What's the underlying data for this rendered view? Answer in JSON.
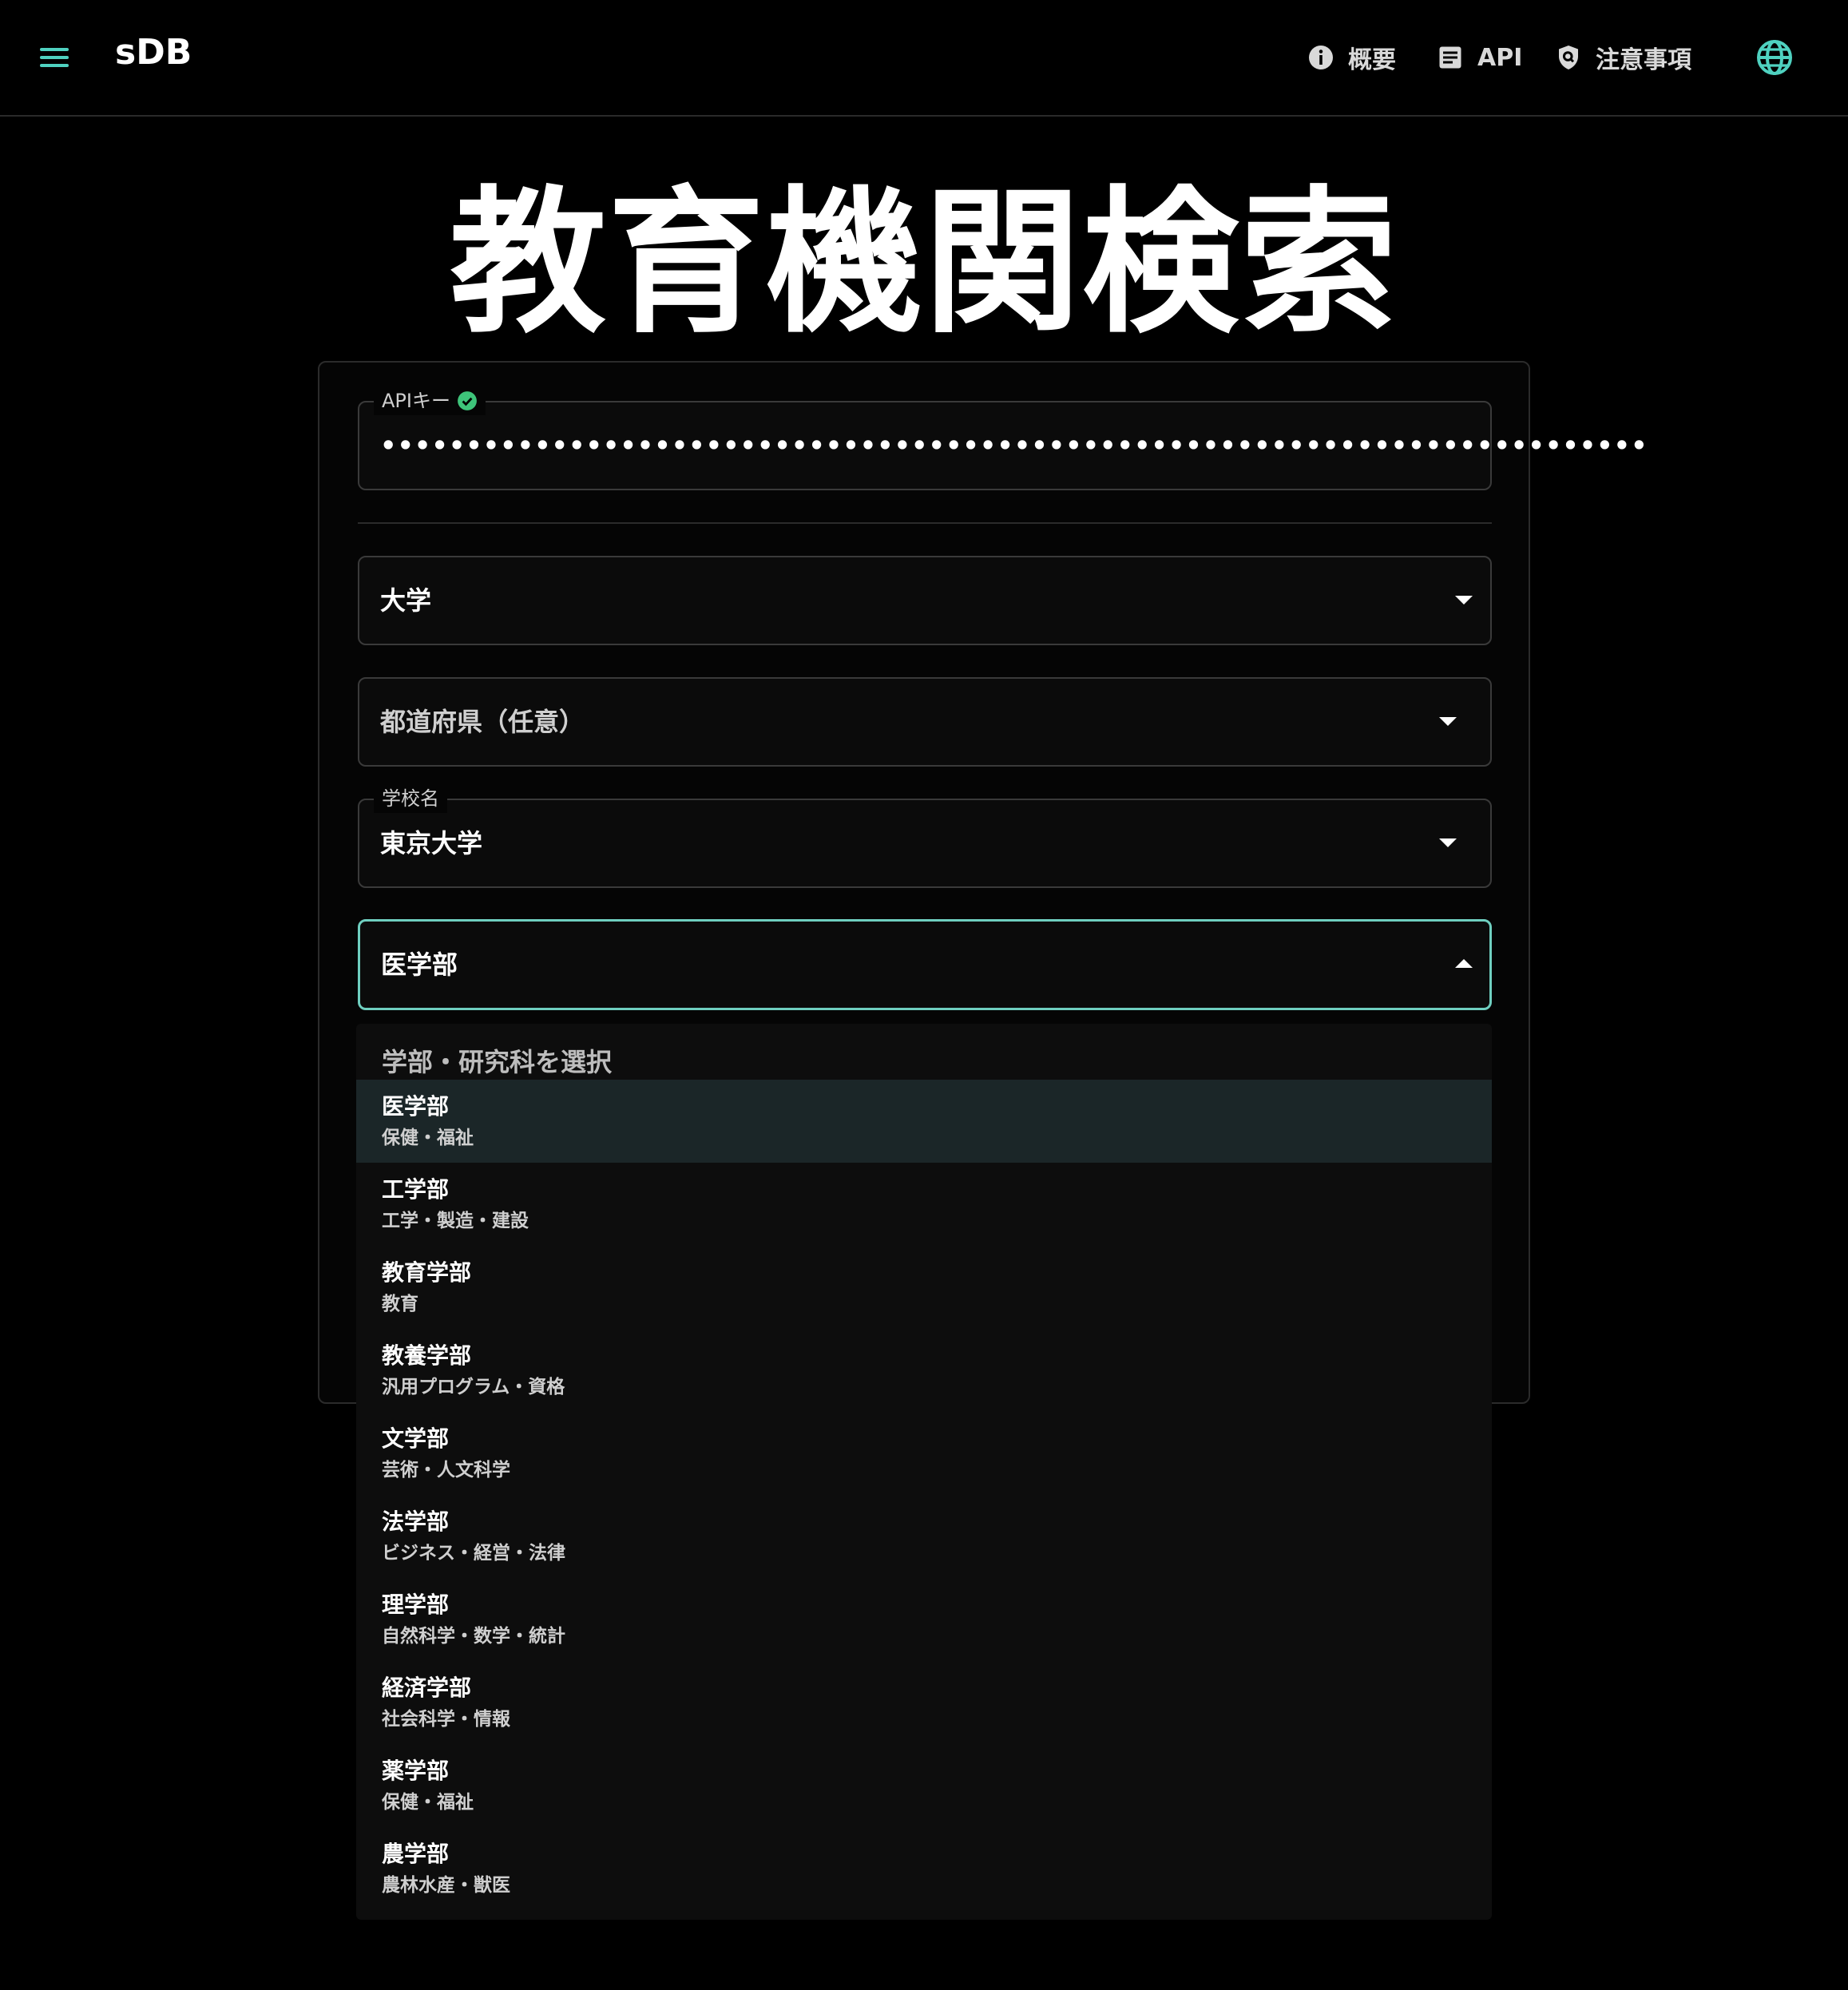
{
  "app": {
    "brand": "sDB"
  },
  "nav": {
    "overview": "概要",
    "api": "API",
    "notes": "注意事項"
  },
  "page": {
    "title": "教育機関検索"
  },
  "form": {
    "api_key": {
      "label": "APIキー",
      "value": "••••••••••••••••••••••••••••••••••••••••••••••••••••••••••••••••••••••••••"
    },
    "school_type": {
      "value": "大学"
    },
    "prefecture": {
      "placeholder": "都道府県（任意）"
    },
    "school_name": {
      "label": "学校名",
      "value": "東京大学"
    },
    "faculty": {
      "value": "医学部"
    }
  },
  "dropdown": {
    "header": "学部・研究科を選択",
    "items": [
      {
        "title": "医学部",
        "sub": "保健・福祉"
      },
      {
        "title": "工学部",
        "sub": "工学・製造・建設"
      },
      {
        "title": "教育学部",
        "sub": "教育"
      },
      {
        "title": "教養学部",
        "sub": "汎用プログラム・資格"
      },
      {
        "title": "文学部",
        "sub": "芸術・人文科学"
      },
      {
        "title": "法学部",
        "sub": "ビジネス・経営・法律"
      },
      {
        "title": "理学部",
        "sub": "自然科学・数学・統計"
      },
      {
        "title": "経済学部",
        "sub": "社会科学・情報"
      },
      {
        "title": "薬学部",
        "sub": "保健・福祉"
      },
      {
        "title": "農学部",
        "sub": "農林水産・獣医"
      }
    ]
  },
  "colors": {
    "accent": "#4fd1c0",
    "success": "#3ec47a",
    "selected_bg": "#1b2628"
  }
}
